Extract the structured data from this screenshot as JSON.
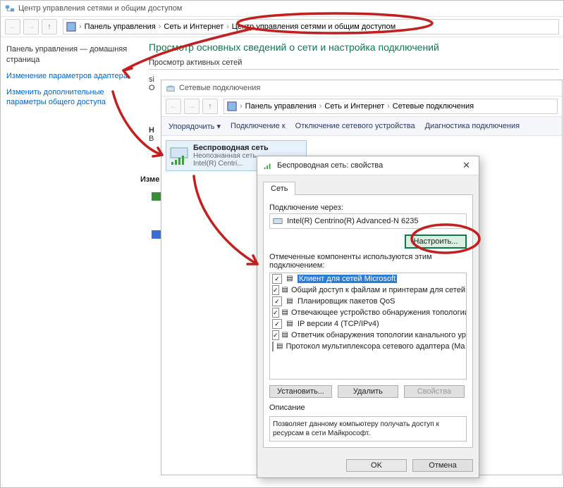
{
  "win_main": {
    "title": "Центр управления сетями и общим доступом",
    "breadcrumbs": [
      "Панель управления",
      "Сеть и Интернет",
      "Центр управления сетями и общим доступом"
    ],
    "heading": "Просмотр основных сведений о сети и настройка подключений",
    "view_active": "Просмотр активных сетей",
    "stub_change_heading": "Изме",
    "stub_side": [
      "si",
      "O",
      "Н",
      "В"
    ]
  },
  "sidebar": {
    "home": "Панель управления — домашняя страница",
    "adapter": "Изменение параметров адаптера",
    "adv": "Изменить дополнительные параметры общего доступа"
  },
  "win_conn": {
    "title": "Сетевые подключения",
    "breadcrumbs": [
      "Панель управления",
      "Сеть и Интернет",
      "Сетевые подключения"
    ],
    "toolbar": {
      "org": "Упорядочить",
      "connect": "Подключение к",
      "disable": "Отключение сетевого устройства",
      "diag": "Диагностика подключения"
    },
    "item": {
      "name": "Беспроводная сеть",
      "status": "Неопознанная сеть",
      "dev": "Intel(R) Centri..."
    }
  },
  "dlg": {
    "title": "Беспроводная сеть: свойства",
    "tab": "Сеть",
    "connect_via": "Подключение через:",
    "adapter": "Intel(R) Centrino(R) Advanced-N 6235",
    "configure": "Настроить...",
    "components_label": "Отмеченные компоненты используются этим подключением:",
    "components": [
      {
        "checked": true,
        "sel": true,
        "name": "Клиент для сетей Microsoft"
      },
      {
        "checked": true,
        "sel": false,
        "name": "Общий доступ к файлам и принтерам для сетей Mi"
      },
      {
        "checked": true,
        "sel": false,
        "name": "Планировщик пакетов QoS"
      },
      {
        "checked": true,
        "sel": false,
        "name": "Отвечающее устройство обнаружения топологии к"
      },
      {
        "checked": true,
        "sel": false,
        "name": "IP версии 4 (TCP/IPv4)"
      },
      {
        "checked": true,
        "sel": false,
        "name": "Ответчик обнаружения топологии канального уро"
      },
      {
        "checked": false,
        "sel": false,
        "name": "Протокол мультиплексора сетевого адаптера (Ma"
      }
    ],
    "install": "Установить...",
    "remove": "Удалить",
    "props": "Свойства",
    "desc_label": "Описание",
    "desc": "Позволяет данному компьютеру получать доступ к ресурсам в сети Майкрософт.",
    "ok": "OK",
    "cancel": "Отмена"
  }
}
